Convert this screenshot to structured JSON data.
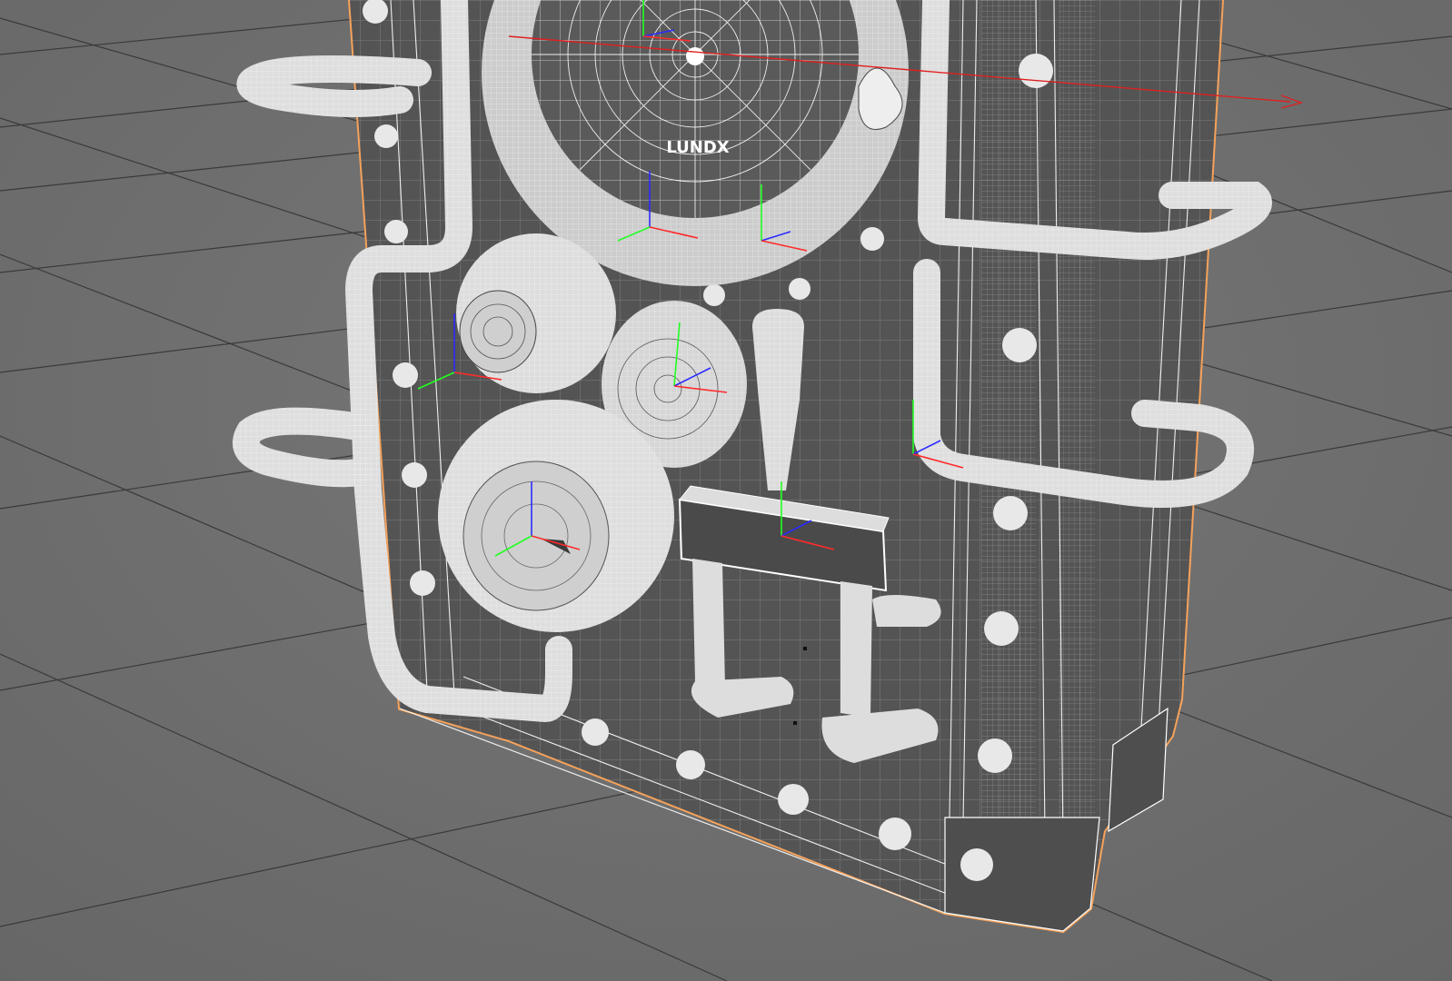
{
  "viewport": {
    "view_mode": "wireframe-on-shaded",
    "background_color": "#6e6e6e",
    "grid_color": "#3a3a3a",
    "wire_color": "#ffffff",
    "selection_outline_color": "#f5a25b",
    "object_fill_color": "#555555",
    "axis_colors": {
      "x": "#ff2a2a",
      "y": "#22ff22",
      "z": "#2a2aff"
    }
  },
  "model": {
    "gauge_label": "LUNDX"
  },
  "icons": {
    "world_axis_arrow": "arrow-right-icon",
    "pivot_gizmo": "axis-gizmo-icon"
  }
}
